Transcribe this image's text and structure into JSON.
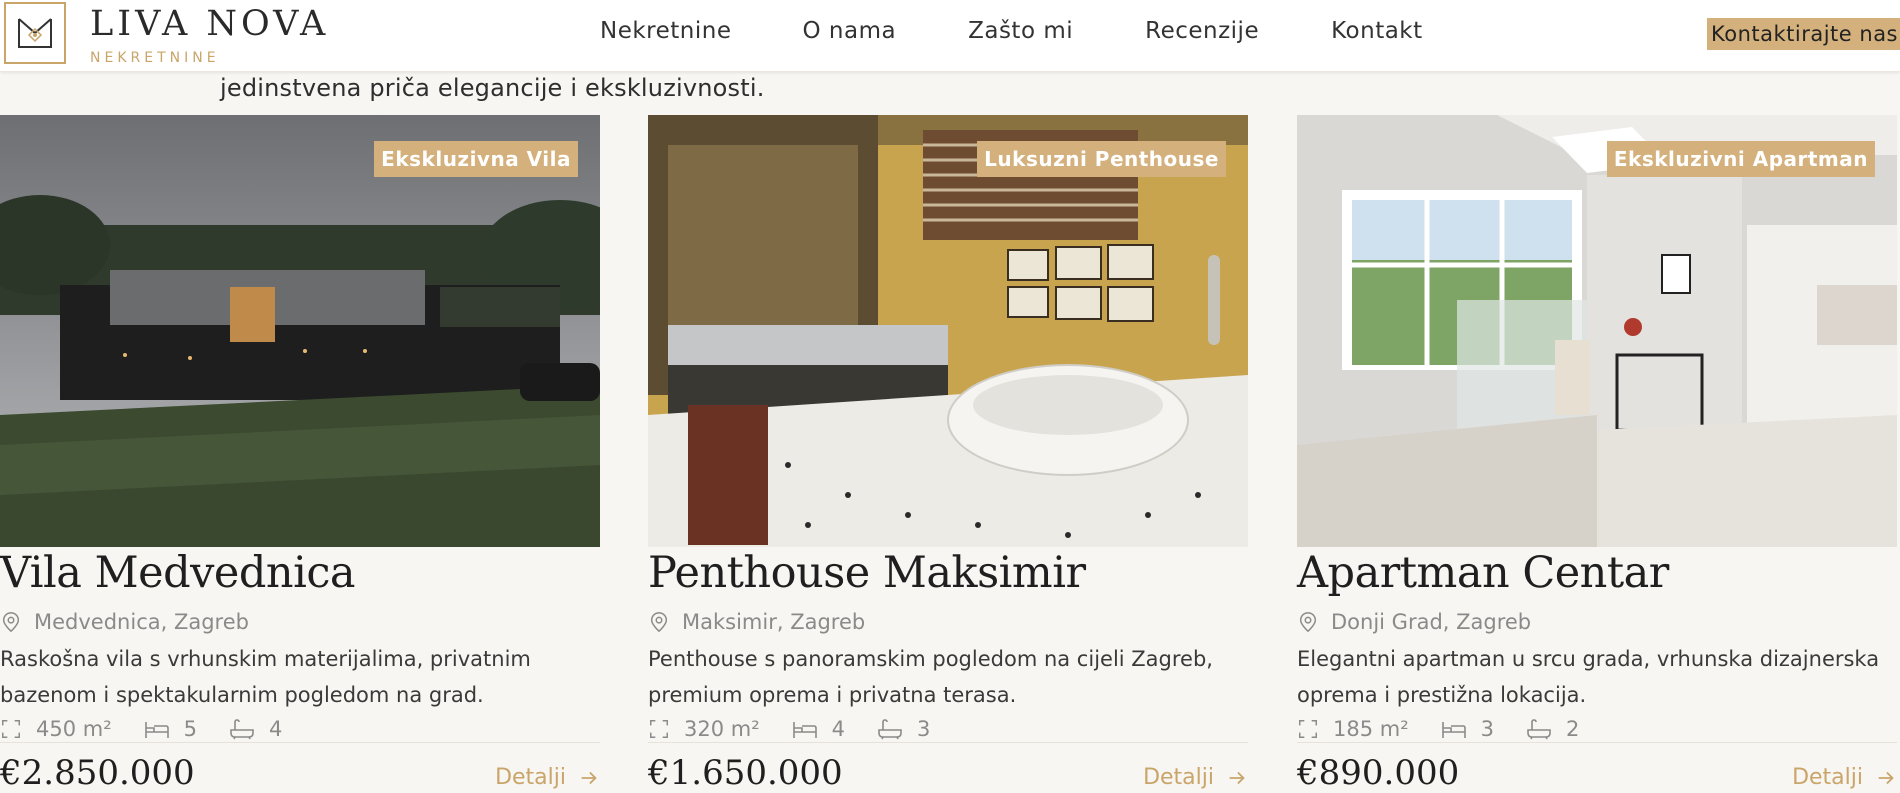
{
  "brand": {
    "name": "LIVA NOVA",
    "tagline": "NEKRETNINE",
    "accent": "#c9a56a"
  },
  "nav": {
    "items": [
      {
        "label": "Nekretnine"
      },
      {
        "label": "O nama"
      },
      {
        "label": "Zašto mi"
      },
      {
        "label": "Recenzije"
      },
      {
        "label": "Kontakt"
      }
    ],
    "cta": "Kontaktirajte nas"
  },
  "intro": "jedinstvena priča elegancije i ekskluzivnosti.",
  "properties": [
    {
      "badge": "Ekskluzivna Vila",
      "title": "Vila Medvednica",
      "location": "Medvednica, Zagreb",
      "description": "Raskošna vila s vrhunskim materijalima, privatnim bazenom i spektakularnim pogledom na grad.",
      "area": "450 m²",
      "beds": "5",
      "baths": "4",
      "price": "€2.850.000",
      "details_label": "Detalji",
      "image": "modern-villa-dusk"
    },
    {
      "badge": "Luksuzni Penthouse",
      "title": "Penthouse Maksimir",
      "location": "Maksimir, Zagreb",
      "description": "Penthouse s panoramskim pogledom na cijeli Zagreb, premium oprema i privatna terasa.",
      "area": "320 m²",
      "beds": "4",
      "baths": "3",
      "price": "€1.650.000",
      "details_label": "Detalji",
      "image": "bathroom-clawfoot-tub"
    },
    {
      "badge": "Ekskluzivni Apartman",
      "title": "Apartman Centar",
      "location": "Donji Grad, Zagreb",
      "description": "Elegantni apartman u srcu grada, vrhunska dizajnerska oprema i prestižna lokacija.",
      "area": "185 m²",
      "beds": "3",
      "baths": "2",
      "price": "€890.000",
      "details_label": "Detalji",
      "image": "bright-apartment-interior"
    }
  ]
}
